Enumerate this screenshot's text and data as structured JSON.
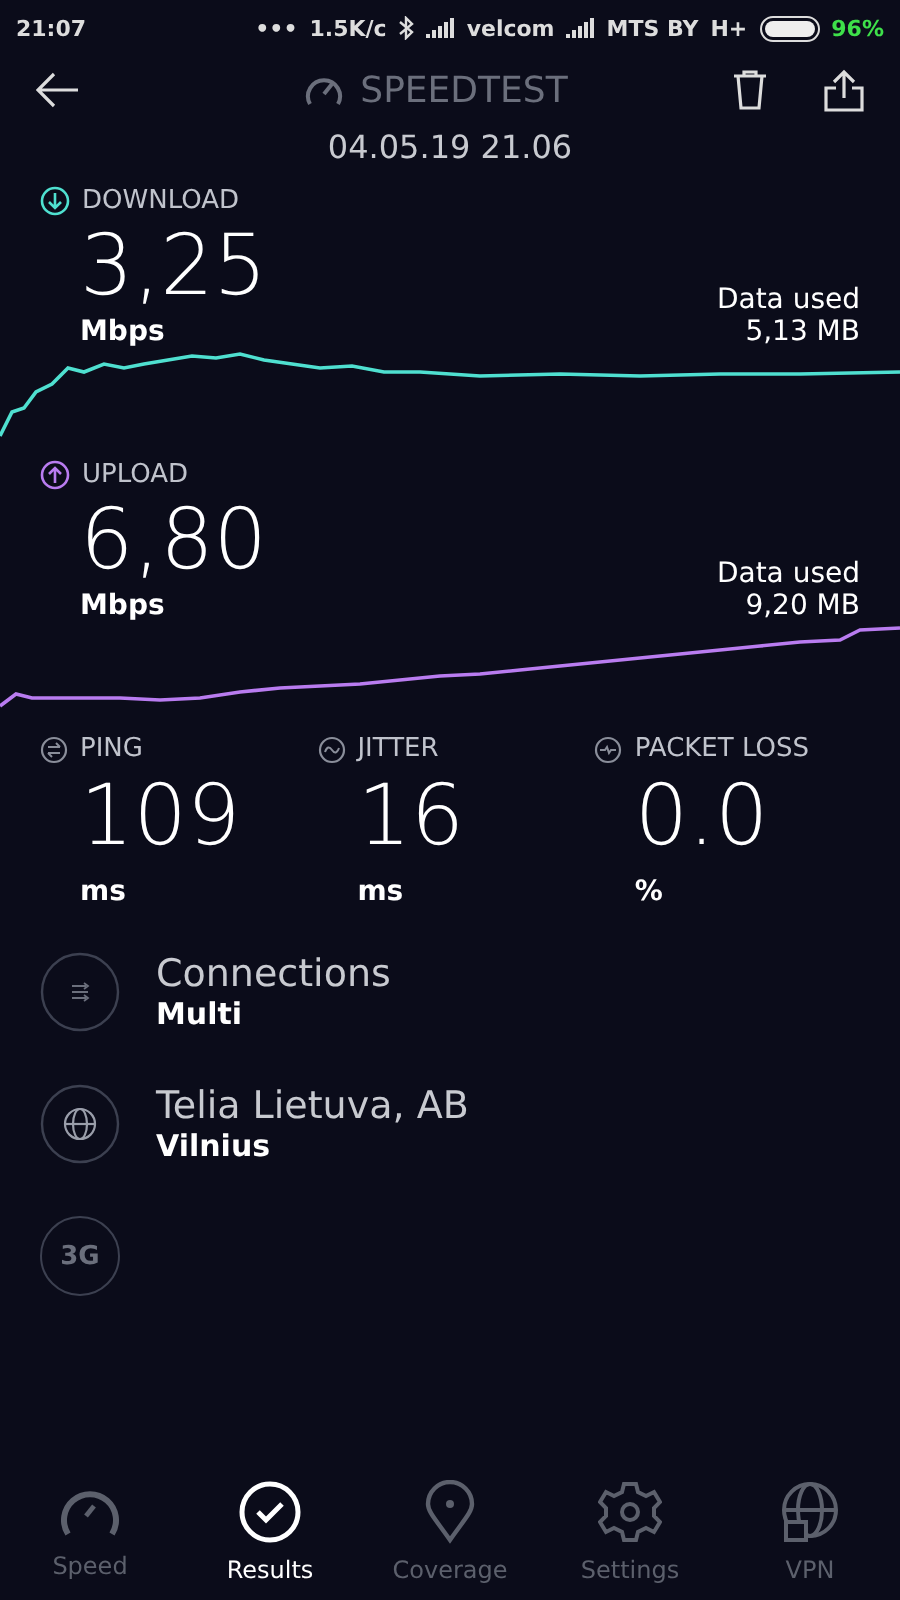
{
  "status_bar": {
    "time": "21:07",
    "dots": "•••",
    "speed": "1.5K/c",
    "carrier_1": "velcom",
    "carrier_2": "MTS BY",
    "network": "H+",
    "battery": "96%"
  },
  "header": {
    "title": "SPEEDTEST",
    "date": "04.05.19 21.06"
  },
  "results": [
    {
      "kind": "download",
      "label": "DOWNLOAD",
      "value": "3,25",
      "unit": "Mbps",
      "data_label": "Data used",
      "data_value": "5,13 MB",
      "color": "#4fe0d0"
    },
    {
      "kind": "upload",
      "label": "UPLOAD",
      "value": "6,80",
      "unit": "Mbps",
      "data_label": "Data used",
      "data_value": "9,20 MB",
      "color": "#b97cf0"
    }
  ],
  "stats": [
    {
      "kind": "ping",
      "label": "PING",
      "value": "109",
      "unit": "ms"
    },
    {
      "kind": "jitter",
      "label": "JITTER",
      "value": "16",
      "unit": "ms"
    },
    {
      "kind": "loss",
      "label": "PACKET LOSS",
      "value": "0.0",
      "unit": "%"
    }
  ],
  "info": [
    {
      "kind": "connections",
      "title": "Connections",
      "subtitle": "Multi"
    },
    {
      "kind": "server",
      "title": "Telia Lietuva, AB",
      "subtitle": "Vilnius"
    },
    {
      "kind": "network",
      "badge": "3G"
    }
  ],
  "nav": [
    {
      "kind": "speed",
      "label": "Speed",
      "selected": false
    },
    {
      "kind": "results",
      "label": "Results",
      "selected": true
    },
    {
      "kind": "coverage",
      "label": "Coverage",
      "selected": false
    },
    {
      "kind": "settings",
      "label": "Settings",
      "selected": false
    },
    {
      "kind": "vpn",
      "label": "VPN",
      "selected": false
    }
  ]
}
